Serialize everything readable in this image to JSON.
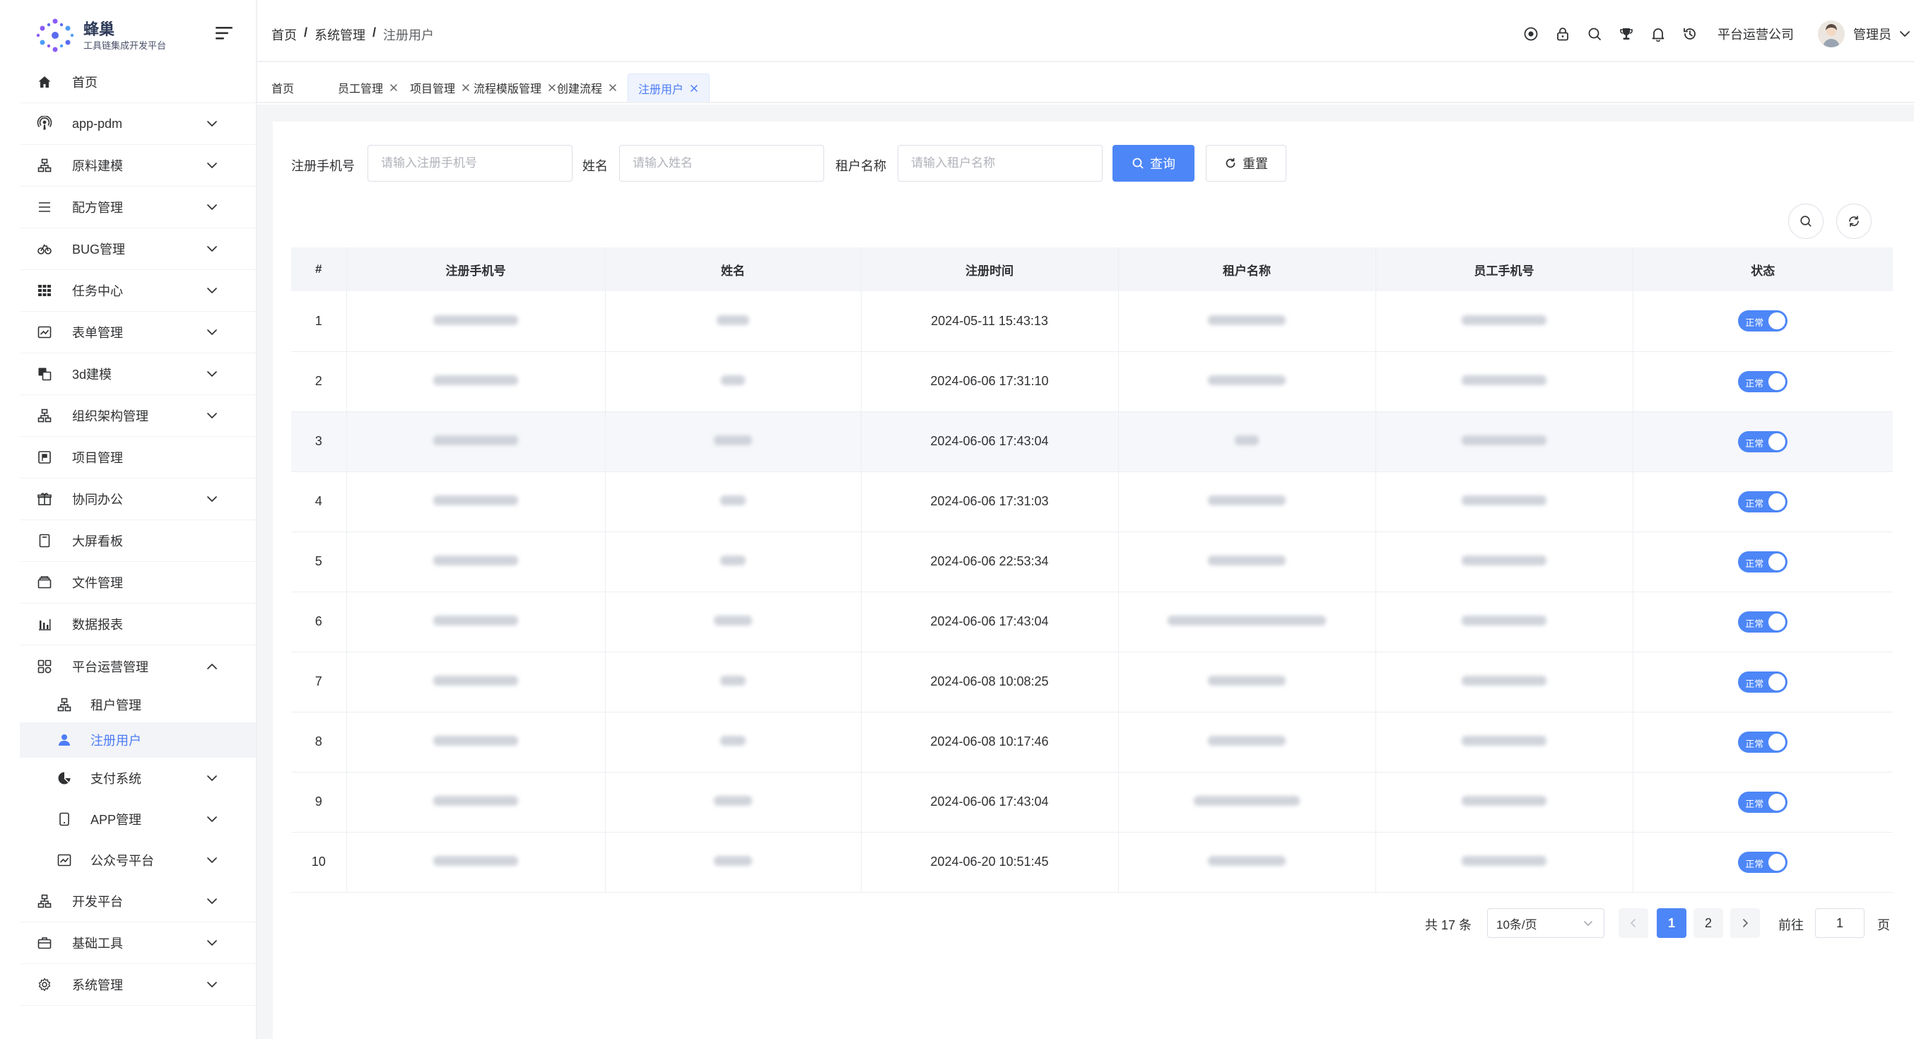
{
  "app": {
    "name": "蜂巢",
    "subtitle": "工具链集成开发平台",
    "brand_color": "#4d86f7"
  },
  "breadcrumb": [
    "首页",
    "系统管理",
    "注册用户"
  ],
  "header": {
    "icons": [
      "help-circle-icon",
      "lock-icon",
      "search-icon",
      "trophy-icon",
      "bell-icon",
      "history-icon"
    ],
    "org_name": "平台运营公司",
    "user_name": "管理员"
  },
  "sidebar": {
    "items": [
      {
        "label": "首页",
        "icon": "home-icon",
        "arrow": false
      },
      {
        "label": "app-pdm",
        "icon": "podcast-icon",
        "arrow": true
      },
      {
        "label": "原料建模",
        "icon": "hierarchy-icon",
        "arrow": true
      },
      {
        "label": "配方管理",
        "icon": "list-icon",
        "arrow": true
      },
      {
        "label": "BUG管理",
        "icon": "bicycle-icon",
        "arrow": true
      },
      {
        "label": "任务中心",
        "icon": "grid-icon",
        "arrow": true
      },
      {
        "label": "表单管理",
        "icon": "chart-box-icon",
        "arrow": true
      },
      {
        "label": "3d建模",
        "icon": "copy-icon",
        "arrow": true
      },
      {
        "label": "组织架构管理",
        "icon": "hierarchy-icon",
        "arrow": true
      },
      {
        "label": "项目管理",
        "icon": "flag-icon",
        "arrow": false
      },
      {
        "label": "协同办公",
        "icon": "gift-icon",
        "arrow": true
      },
      {
        "label": "大屏看板",
        "icon": "tablet-icon",
        "arrow": false
      },
      {
        "label": "文件管理",
        "icon": "box-icon",
        "arrow": false
      },
      {
        "label": "数据报表",
        "icon": "bar-chart-icon",
        "arrow": false
      },
      {
        "label": "平台运营管理",
        "icon": "apps-icon",
        "arrow": true,
        "expanded": true
      }
    ],
    "sub_items": [
      {
        "label": "租户管理",
        "icon": "hierarchy-icon",
        "arrow": false
      },
      {
        "label": "注册用户",
        "icon": "user-icon",
        "arrow": false,
        "active": true
      },
      {
        "label": "支付系统",
        "icon": "pie-icon",
        "arrow": true
      },
      {
        "label": "APP管理",
        "icon": "phone-icon",
        "arrow": true
      },
      {
        "label": "公众号平台",
        "icon": "chart-box-icon",
        "arrow": true
      }
    ],
    "bottom_items": [
      {
        "label": "开发平台",
        "icon": "hierarchy-icon",
        "arrow": true
      },
      {
        "label": "基础工具",
        "icon": "briefcase-icon",
        "arrow": true
      },
      {
        "label": "系统管理",
        "icon": "gear-icon",
        "arrow": true
      }
    ]
  },
  "tabs": [
    {
      "label": "首页",
      "closable": false
    },
    {
      "label": "员工管理",
      "closable": true
    },
    {
      "label": "项目管理",
      "closable": true
    },
    {
      "label": "流程模版管理",
      "closable": true
    },
    {
      "label": "创建流程",
      "closable": true
    },
    {
      "label": "注册用户",
      "closable": true,
      "active": true
    }
  ],
  "search": {
    "phone_label": "注册手机号",
    "phone_placeholder": "请输入注册手机号",
    "name_label": "姓名",
    "name_placeholder": "请输入姓名",
    "tenant_label": "租户名称",
    "tenant_placeholder": "请输入租户名称",
    "query_button": "查询",
    "reset_button": "重置"
  },
  "table": {
    "columns": [
      "#",
      "注册手机号",
      "姓名",
      "注册时间",
      "租户名称",
      "员工手机号",
      "状态"
    ],
    "rows": [
      {
        "index": "1",
        "time": "2024-05-11 15:43:13",
        "status": "正常"
      },
      {
        "index": "2",
        "time": "2024-06-06 17:31:10",
        "status": "正常"
      },
      {
        "index": "3",
        "time": "2024-06-06 17:43:04",
        "status": "正常"
      },
      {
        "index": "4",
        "time": "2024-06-06 17:31:03",
        "status": "正常"
      },
      {
        "index": "5",
        "time": "2024-06-06 22:53:34",
        "status": "正常"
      },
      {
        "index": "6",
        "time": "2024-06-06 17:43:04",
        "status": "正常"
      },
      {
        "index": "7",
        "time": "2024-06-08 10:08:25",
        "status": "正常"
      },
      {
        "index": "8",
        "time": "2024-06-08 10:17:46",
        "status": "正常"
      },
      {
        "index": "9",
        "time": "2024-06-06 17:43:04",
        "status": "正常"
      },
      {
        "index": "10",
        "time": "2024-06-20 10:51:45",
        "status": "正常"
      }
    ]
  },
  "pagination": {
    "total": "共 17 条",
    "page_size": "10条/页",
    "pages": [
      "1",
      "2"
    ],
    "current": "1",
    "goto_label": "前往",
    "goto_value": "1",
    "unit": "页"
  }
}
